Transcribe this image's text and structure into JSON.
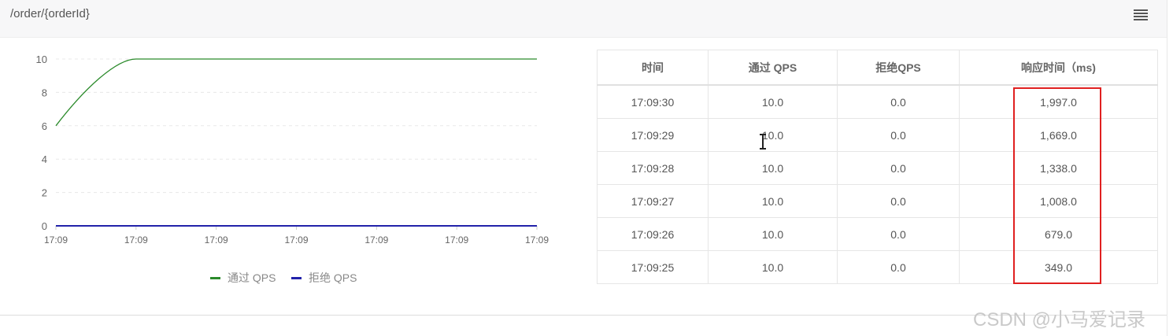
{
  "panel": {
    "title": "/order/{orderId}",
    "menu_icon": "hamburger-menu-icon"
  },
  "legend": {
    "pass_label": "通过 QPS",
    "reject_label": "拒绝 QPS"
  },
  "colors": {
    "pass_series": "#2a8a2a",
    "reject_series": "#2222aa",
    "highlight_border": "#e02020"
  },
  "chart_data": {
    "type": "line",
    "x": [
      "17:09",
      "17:09",
      "17:09",
      "17:09",
      "17:09",
      "17:09",
      "17:09"
    ],
    "ylim": [
      0,
      10
    ],
    "y_ticks": [
      0,
      2,
      4,
      6,
      8,
      10
    ],
    "grid": true,
    "legend_position": "bottom",
    "series": [
      {
        "name": "通过 QPS",
        "values": [
          6,
          10,
          10,
          10,
          10,
          10,
          10
        ]
      },
      {
        "name": "拒绝 QPS",
        "values": [
          0,
          0,
          0,
          0,
          0,
          0,
          0
        ]
      }
    ]
  },
  "table": {
    "headers": [
      "时间",
      "通过 QPS",
      "拒绝QPS",
      "响应时间（ms)"
    ],
    "rows": [
      [
        "17:09:30",
        "10.0",
        "0.0",
        "1,997.0"
      ],
      [
        "17:09:29",
        "10.0",
        "0.0",
        "1,669.0"
      ],
      [
        "17:09:28",
        "10.0",
        "0.0",
        "1,338.0"
      ],
      [
        "17:09:27",
        "10.0",
        "0.0",
        "1,008.0"
      ],
      [
        "17:09:26",
        "10.0",
        "0.0",
        "679.0"
      ],
      [
        "17:09:25",
        "10.0",
        "0.0",
        "349.0"
      ]
    ]
  },
  "watermark": "CSDN @小马爱记录"
}
